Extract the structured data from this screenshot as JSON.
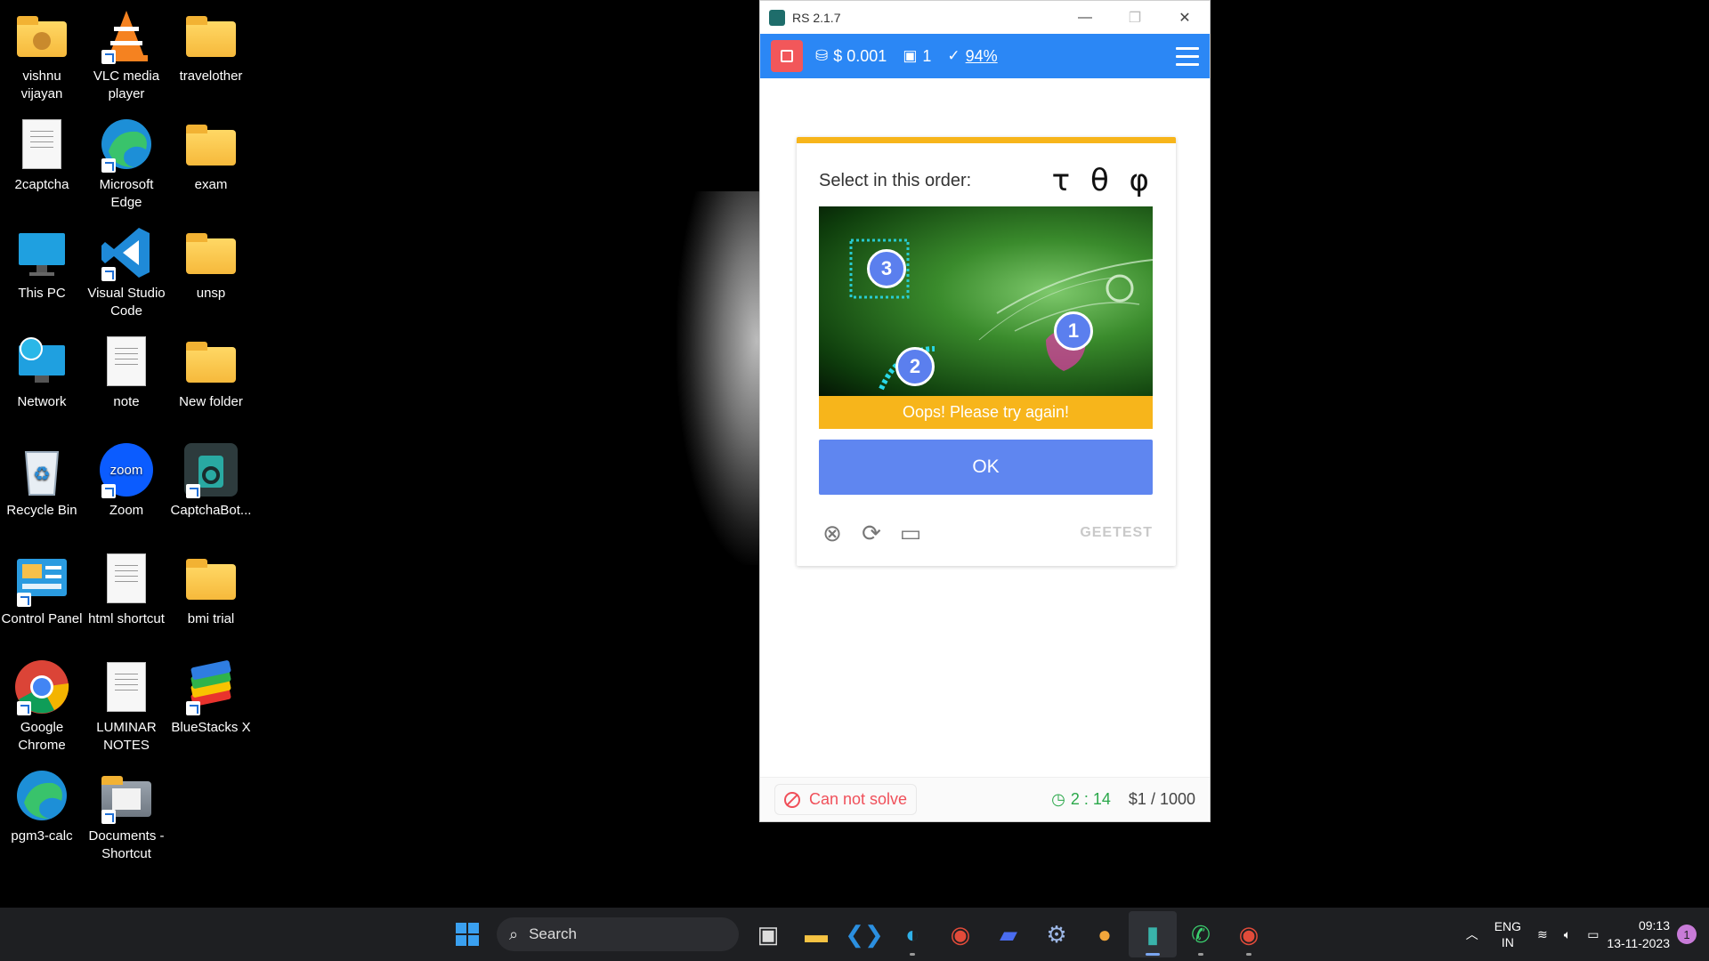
{
  "desktop": {
    "icons": [
      {
        "label": "vishnu vijayan",
        "icon": "user-folder-icon"
      },
      {
        "label": "VLC media player",
        "icon": "vlc-icon"
      },
      {
        "label": "travelother",
        "icon": "folder-icon"
      },
      {
        "label": "2captcha",
        "icon": "document-icon"
      },
      {
        "label": "Microsoft Edge",
        "icon": "edge-icon"
      },
      {
        "label": "exam",
        "icon": "folder-icon"
      },
      {
        "label": "This PC",
        "icon": "monitor-icon"
      },
      {
        "label": "Visual Studio Code",
        "icon": "vscode-icon"
      },
      {
        "label": "unsp",
        "icon": "folder-icon"
      },
      {
        "label": "Network",
        "icon": "network-icon"
      },
      {
        "label": "note",
        "icon": "document-icon"
      },
      {
        "label": "New folder",
        "icon": "folder-icon"
      },
      {
        "label": "Recycle Bin",
        "icon": "recycle-bin-icon"
      },
      {
        "label": "Zoom",
        "icon": "zoom-icon"
      },
      {
        "label": "CaptchaBot...",
        "icon": "captchabot-icon"
      },
      {
        "label": "Control Panel",
        "icon": "control-panel-icon"
      },
      {
        "label": "html shortcut",
        "icon": "document-icon"
      },
      {
        "label": "bmi trial",
        "icon": "folder-icon"
      },
      {
        "label": "Google Chrome",
        "icon": "chrome-icon"
      },
      {
        "label": "LUMINAR NOTES",
        "icon": "document-icon"
      },
      {
        "label": "BlueStacks X",
        "icon": "bluestacks-icon"
      },
      {
        "label": "pgm3-calc",
        "icon": "edge-icon"
      },
      {
        "label": "Documents - Shortcut",
        "icon": "documents-folder-icon"
      }
    ]
  },
  "window": {
    "title": "RS 2.1.7",
    "toolbar": {
      "cost": "$ 0.001",
      "count": "1",
      "accuracy": "94%"
    },
    "captcha": {
      "prompt": "Select in this order:",
      "glyphs": "τ θ φ",
      "markers": [
        "1",
        "2",
        "3"
      ],
      "error_message": "Oops! Please try again!",
      "ok_label": "OK",
      "brand": "GEETEST"
    },
    "status": {
      "cannot_solve": "Can not solve",
      "timer": "2 : 14",
      "balance": "$1 / 1000"
    }
  },
  "taskbar": {
    "search_label": "Search",
    "language": "ENG",
    "region": "IN",
    "time": "09:13",
    "date": "13-11-2023",
    "notification_count": "1"
  }
}
